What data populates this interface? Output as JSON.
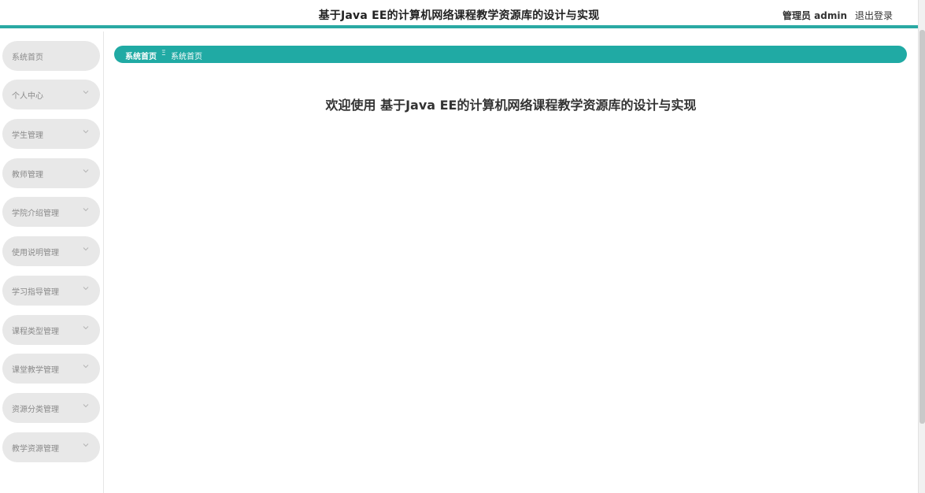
{
  "header": {
    "title": "基于Java EE的计算机网络课程教学资源库的设计与实现",
    "user": "管理员 admin",
    "logout": "退出登录"
  },
  "sidebar": {
    "items": [
      {
        "label": "系统首页",
        "has_chevron": false
      },
      {
        "label": "个人中心",
        "has_chevron": true
      },
      {
        "label": "学生管理",
        "has_chevron": true
      },
      {
        "label": "教师管理",
        "has_chevron": true
      },
      {
        "label": "学院介绍管理",
        "has_chevron": true
      },
      {
        "label": "使用说明管理",
        "has_chevron": true
      },
      {
        "label": "学习指导管理",
        "has_chevron": true
      },
      {
        "label": "课程类型管理",
        "has_chevron": true
      },
      {
        "label": "课堂教学管理",
        "has_chevron": true
      },
      {
        "label": "资源分类管理",
        "has_chevron": true
      },
      {
        "label": "教学资源管理",
        "has_chevron": true
      }
    ]
  },
  "breadcrumb": {
    "home": "系统首页",
    "separator": "Ξ",
    "current": "系统首页"
  },
  "main": {
    "welcome": "欢迎使用 基于Java EE的计算机网络课程教学资源库的设计与实现"
  },
  "colors": {
    "accent": "#20aaa4",
    "sidebar_item_bg": "#e8e8e8"
  }
}
